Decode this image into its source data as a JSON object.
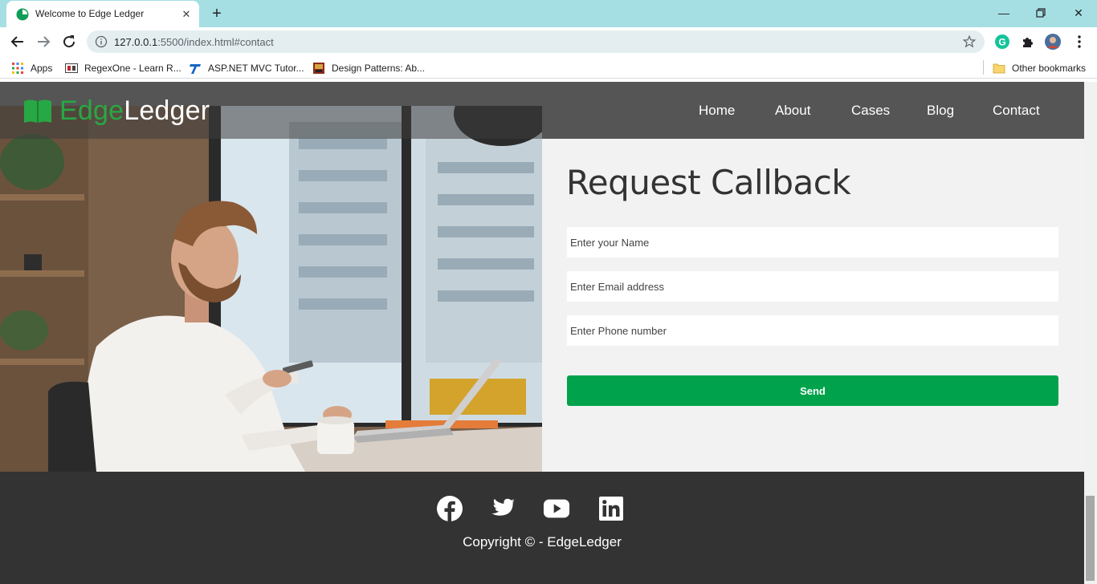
{
  "browser": {
    "tab_title": "Welcome to Edge Ledger",
    "url_host": "127.0.0.1",
    "url_rest": ":5500/index.html#contact",
    "bookmarks": [
      {
        "label": "Apps"
      },
      {
        "label": "RegexOne - Learn R..."
      },
      {
        "label": "ASP.NET MVC Tutor..."
      },
      {
        "label": "Design Patterns: Ab..."
      }
    ],
    "other_bookmarks": "Other bookmarks"
  },
  "site": {
    "logo_part1": "Edge",
    "logo_part2": "Ledger",
    "nav": [
      {
        "label": "Home"
      },
      {
        "label": "About"
      },
      {
        "label": "Cases"
      },
      {
        "label": "Blog"
      },
      {
        "label": "Contact"
      }
    ]
  },
  "form": {
    "title": "Request Callback",
    "name_placeholder": "Enter your Name",
    "email_placeholder": "Enter Email address",
    "phone_placeholder": "Enter Phone number",
    "send_label": "Send"
  },
  "footer": {
    "social": [
      "facebook-icon",
      "twitter-icon",
      "youtube-icon",
      "linkedin-icon"
    ],
    "copyright": "Copyright © - EdgeLedger"
  },
  "colors": {
    "brand_green": "#00a34c",
    "tabstrip": "#a5dfe3",
    "navbar": "#555555",
    "footer": "#333333"
  }
}
